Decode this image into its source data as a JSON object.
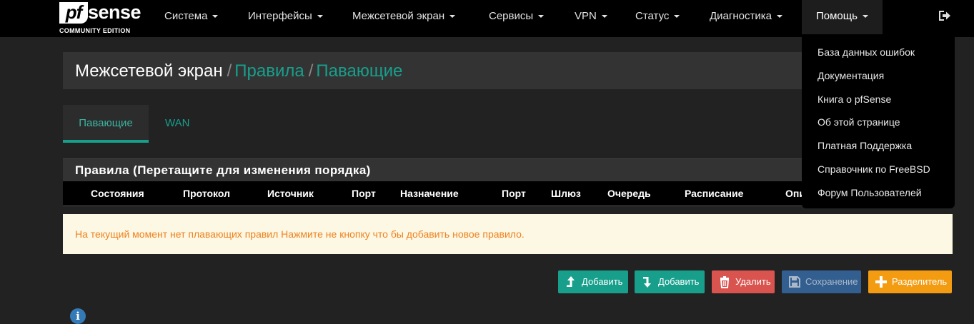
{
  "brand": {
    "logo_pf": "pf",
    "logo_sense": "sense",
    "logo_reg": "®",
    "edition": "COMMUNITY EDITION"
  },
  "nav": {
    "items": [
      {
        "label": "Система"
      },
      {
        "label": "Интерфейсы"
      },
      {
        "label": "Межсетевой экран"
      },
      {
        "label": "Сервисы"
      },
      {
        "label": "VPN"
      },
      {
        "label": "Статус"
      },
      {
        "label": "Диагностика"
      },
      {
        "label": "Помощь"
      }
    ],
    "logout_icon": "logout-icon"
  },
  "breadcrumb": {
    "root": "Межсетевой экран",
    "sep": "/",
    "level1": "Правила",
    "level2": "Павающие"
  },
  "tabs": [
    {
      "label": "Павающие",
      "active": true
    },
    {
      "label": "WAN",
      "active": false
    }
  ],
  "panel": {
    "title": "Правила (Перетащите для изменения порядка)",
    "columns": [
      "Состояния",
      "Протокол",
      "Источник",
      "Порт",
      "Назначение",
      "Порт",
      "Шлюз",
      "Очередь",
      "Расписание",
      "Опи"
    ]
  },
  "alert": {
    "text": "На текущий момент нет плавающих правил Нажмите не кнопку что бы добавить новое правило."
  },
  "buttons": {
    "add_top": "Добавить",
    "add_bottom": "Добавить",
    "delete": "Удалить",
    "save": "Сохранение",
    "separator": "Разделитель"
  },
  "help_menu": {
    "items": [
      "База данных ошибок",
      "Документация",
      "Книга о pfSense",
      "Об этой странице",
      "Платная Поддержка",
      "Справочник по FreeBSD",
      "Форум Пользователей"
    ]
  },
  "info": {
    "glyph": "i"
  },
  "colors": {
    "accent": "#189f8c",
    "navbar": "#000000",
    "background": "#222222",
    "alert_bg": "#fcf8e3",
    "alert_text": "#f0811f",
    "danger": "#d9534f",
    "warning": "#f39c12",
    "save": "#335f90"
  }
}
